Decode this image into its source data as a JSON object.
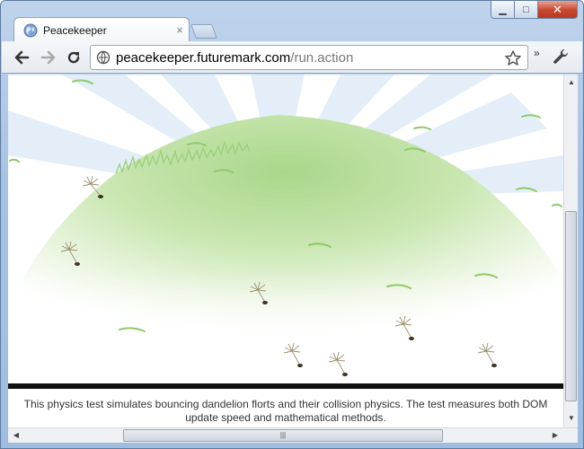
{
  "window": {
    "minimize_glyph": "▁",
    "maximize_glyph": "□",
    "close_glyph": "✕"
  },
  "tab": {
    "title": "Peacekeeper",
    "close_glyph": "×"
  },
  "toolbar": {
    "url_host": "peacekeeper.futuremark.com",
    "url_path": "/run.action",
    "more_glyph": "»"
  },
  "page": {
    "description": "This physics test simulates bouncing dandelion florts and their collision physics. The test measures both DOM update speed and mathematical methods."
  },
  "scrollbars": {
    "up_glyph": "▲",
    "down_glyph": "▼",
    "left_glyph": "◀",
    "right_glyph": "▶",
    "grip_glyph": "|||"
  },
  "colors": {
    "hill": "#c9e6b0",
    "rays": "#e4eef8",
    "ground": "#111111"
  }
}
